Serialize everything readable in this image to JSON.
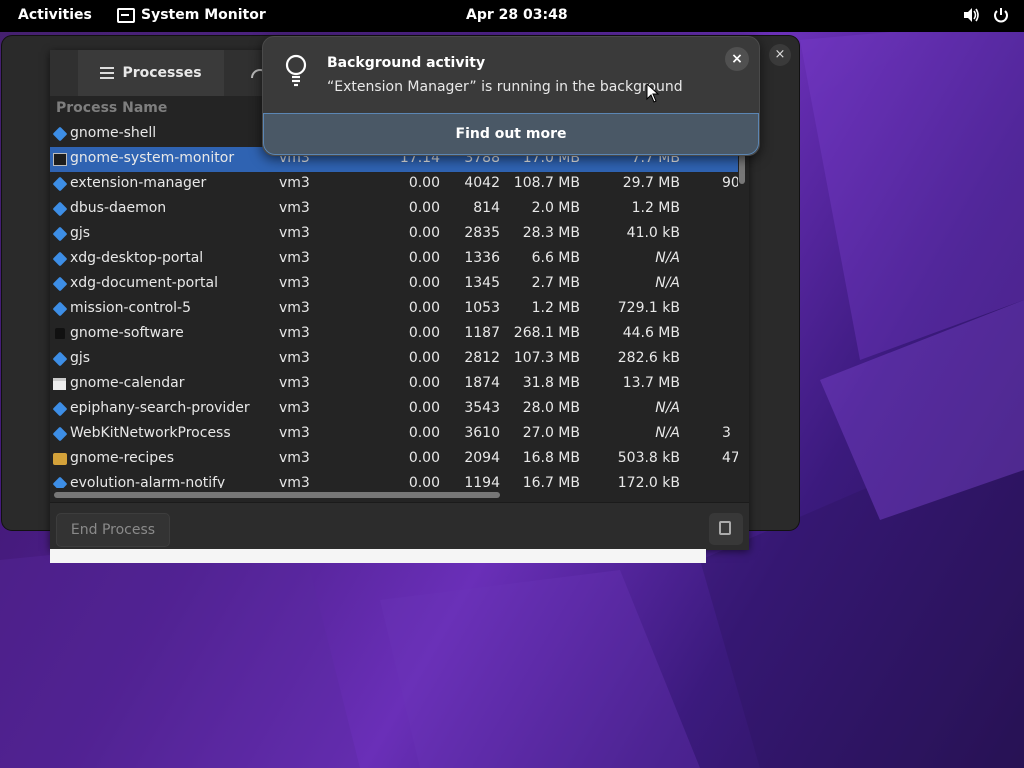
{
  "topbar": {
    "activities": "Activities",
    "app_name": "System Monitor",
    "clock": "Apr 28  03:48",
    "icons": [
      "volume-icon",
      "power-icon"
    ]
  },
  "window": {
    "tab_processes": "Processes",
    "column_process_name": "Process Name",
    "end_process": "End Process",
    "processes": [
      {
        "icon": "diamond",
        "name": "gnome-shell",
        "user": "",
        "cpu": "",
        "id": "",
        "memory": "",
        "disk": "",
        "extra": ""
      },
      {
        "icon": "monitor",
        "name": "gnome-system-monitor",
        "user": "vm3",
        "cpu": "17.14",
        "id": "3788",
        "memory": "17.0 MB",
        "disk": "7.7 MB",
        "extra": "",
        "selected": true
      },
      {
        "icon": "diamond",
        "name": "extension-manager",
        "user": "vm3",
        "cpu": "0.00",
        "id": "4042",
        "memory": "108.7 MB",
        "disk": "29.7 MB",
        "extra": "90"
      },
      {
        "icon": "diamond",
        "name": "dbus-daemon",
        "user": "vm3",
        "cpu": "0.00",
        "id": "814",
        "memory": "2.0 MB",
        "disk": "1.2 MB",
        "extra": ""
      },
      {
        "icon": "diamond",
        "name": "gjs",
        "user": "vm3",
        "cpu": "0.00",
        "id": "2835",
        "memory": "28.3 MB",
        "disk": "41.0 kB",
        "extra": ""
      },
      {
        "icon": "diamond",
        "name": "xdg-desktop-portal",
        "user": "vm3",
        "cpu": "0.00",
        "id": "1336",
        "memory": "6.6 MB",
        "disk": "N/A",
        "extra": ""
      },
      {
        "icon": "diamond",
        "name": "xdg-document-portal",
        "user": "vm3",
        "cpu": "0.00",
        "id": "1345",
        "memory": "2.7 MB",
        "disk": "N/A",
        "extra": ""
      },
      {
        "icon": "diamond",
        "name": "mission-control-5",
        "user": "vm3",
        "cpu": "0.00",
        "id": "1053",
        "memory": "1.2 MB",
        "disk": "729.1 kB",
        "extra": ""
      },
      {
        "icon": "bag",
        "name": "gnome-software",
        "user": "vm3",
        "cpu": "0.00",
        "id": "1187",
        "memory": "268.1 MB",
        "disk": "44.6 MB",
        "extra": ""
      },
      {
        "icon": "diamond",
        "name": "gjs",
        "user": "vm3",
        "cpu": "0.00",
        "id": "2812",
        "memory": "107.3 MB",
        "disk": "282.6 kB",
        "extra": ""
      },
      {
        "icon": "calendar",
        "name": "gnome-calendar",
        "user": "vm3",
        "cpu": "0.00",
        "id": "1874",
        "memory": "31.8 MB",
        "disk": "13.7 MB",
        "extra": ""
      },
      {
        "icon": "diamond",
        "name": "epiphany-search-provider",
        "user": "vm3",
        "cpu": "0.00",
        "id": "3543",
        "memory": "28.0 MB",
        "disk": "N/A",
        "extra": ""
      },
      {
        "icon": "diamond",
        "name": "WebKitNetworkProcess",
        "user": "vm3",
        "cpu": "0.00",
        "id": "3610",
        "memory": "27.0 MB",
        "disk": "N/A",
        "extra": "3"
      },
      {
        "icon": "recipes",
        "name": "gnome-recipes",
        "user": "vm3",
        "cpu": "0.00",
        "id": "2094",
        "memory": "16.8 MB",
        "disk": "503.8 kB",
        "extra": "47"
      },
      {
        "icon": "diamond",
        "name": "evolution-alarm-notify",
        "user": "vm3",
        "cpu": "0.00",
        "id": "1194",
        "memory": "16.7 MB",
        "disk": "172.0 kB",
        "extra": ""
      }
    ]
  },
  "notification": {
    "title": "Background activity",
    "body": "“Extension Manager” is running in the background",
    "action": "Find out more",
    "close": "×"
  },
  "back_window": {
    "close": "×"
  },
  "colors": {
    "selection": "#2f63b2",
    "wallpaper": "#4d1f8c"
  }
}
